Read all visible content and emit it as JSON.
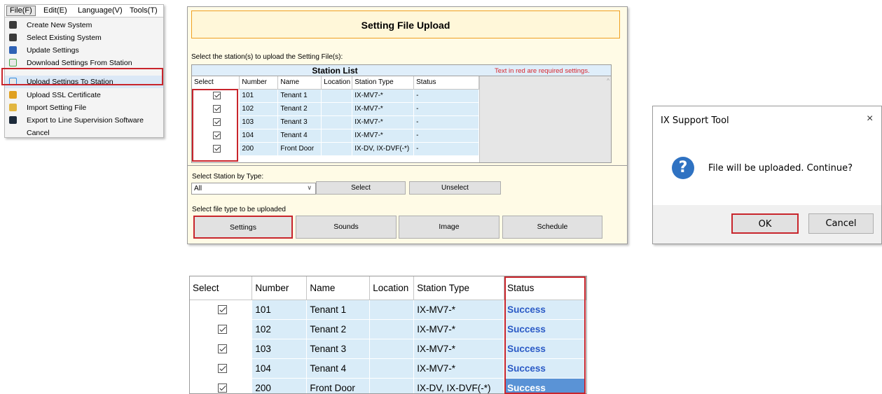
{
  "menu": {
    "menubar": [
      "File(F)",
      "Edit(E)",
      "Language(V)",
      "Tools(T)"
    ],
    "items": [
      {
        "label": "Create New System",
        "icon": "create-system-icon",
        "color": "#3a3a3a"
      },
      {
        "label": "Select Existing System",
        "icon": "existing-system-icon",
        "color": "#3a3a3a"
      },
      {
        "label": "Update Settings",
        "icon": "floppy-disk-icon",
        "color": "#2f62b5"
      },
      {
        "label": "Download Settings From Station",
        "icon": "download-file-icon",
        "color": "#4aa84a"
      },
      {
        "label": "Upload Settings To Station",
        "icon": "upload-file-icon",
        "color": "#2f8be0"
      },
      {
        "label": "Upload SSL Certificate",
        "icon": "lock-icon",
        "color": "#e0a020"
      },
      {
        "label": "Import Setting File",
        "icon": "import-folder-icon",
        "color": "#e2b640"
      },
      {
        "label": "Export to Line Supervision Software",
        "icon": "export-icon",
        "color": "#1c2a3a"
      },
      {
        "label": "Cancel",
        "icon": "",
        "color": ""
      }
    ]
  },
  "upload": {
    "title": "Setting File Upload",
    "select_stations_label": "Select the station(s) to upload the Setting File(s):",
    "station_list_title": "Station List",
    "required_note": "Text in red are required settings.",
    "columns": [
      "Select",
      "Number",
      "Name",
      "Location",
      "Station Type",
      "Status"
    ],
    "rows": [
      {
        "number": "101",
        "name": "Tenant 1",
        "location": "",
        "type": "IX-MV7-*",
        "status": "-"
      },
      {
        "number": "102",
        "name": "Tenant 2",
        "location": "",
        "type": "IX-MV7-*",
        "status": "-"
      },
      {
        "number": "103",
        "name": "Tenant 3",
        "location": "",
        "type": "IX-MV7-*",
        "status": "-"
      },
      {
        "number": "104",
        "name": "Tenant 4",
        "location": "",
        "type": "IX-MV7-*",
        "status": "-"
      },
      {
        "number": "200",
        "name": "Front Door",
        "location": "",
        "type": "IX-DV, IX-DVF(-*)",
        "status": "-"
      }
    ],
    "by_type_label": "Select Station by Type:",
    "type_value": "All",
    "select_label": "Select",
    "unselect_label": "Unselect",
    "file_type_label": "Select file type to be uploaded",
    "file_buttons": [
      "Settings",
      "Sounds",
      "Image",
      "Schedule"
    ]
  },
  "dialog": {
    "title": "IX Support Tool",
    "close": "×",
    "icon_glyph": "?",
    "message": "File will be uploaded. Continue?",
    "ok_label": "OK",
    "cancel_label": "Cancel"
  },
  "results": {
    "columns": [
      "Select",
      "Number",
      "Name",
      "Location",
      "Station Type",
      "Status"
    ],
    "rows": [
      {
        "number": "101",
        "name": "Tenant 1",
        "location": "",
        "type": "IX-MV7-*",
        "status": "Success"
      },
      {
        "number": "102",
        "name": "Tenant 2",
        "location": "",
        "type": "IX-MV7-*",
        "status": "Success"
      },
      {
        "number": "103",
        "name": "Tenant 3",
        "location": "",
        "type": "IX-MV7-*",
        "status": "Success"
      },
      {
        "number": "104",
        "name": "Tenant 4",
        "location": "",
        "type": "IX-MV7-*",
        "status": "Success"
      },
      {
        "number": "200",
        "name": "Front Door",
        "location": "",
        "type": "IX-DV, IX-DVF(-*)",
        "status": "Success"
      }
    ]
  },
  "colors": {
    "highlight": "#c8252c",
    "selection": "#5a93d6",
    "success_text": "#2a5ac6"
  }
}
